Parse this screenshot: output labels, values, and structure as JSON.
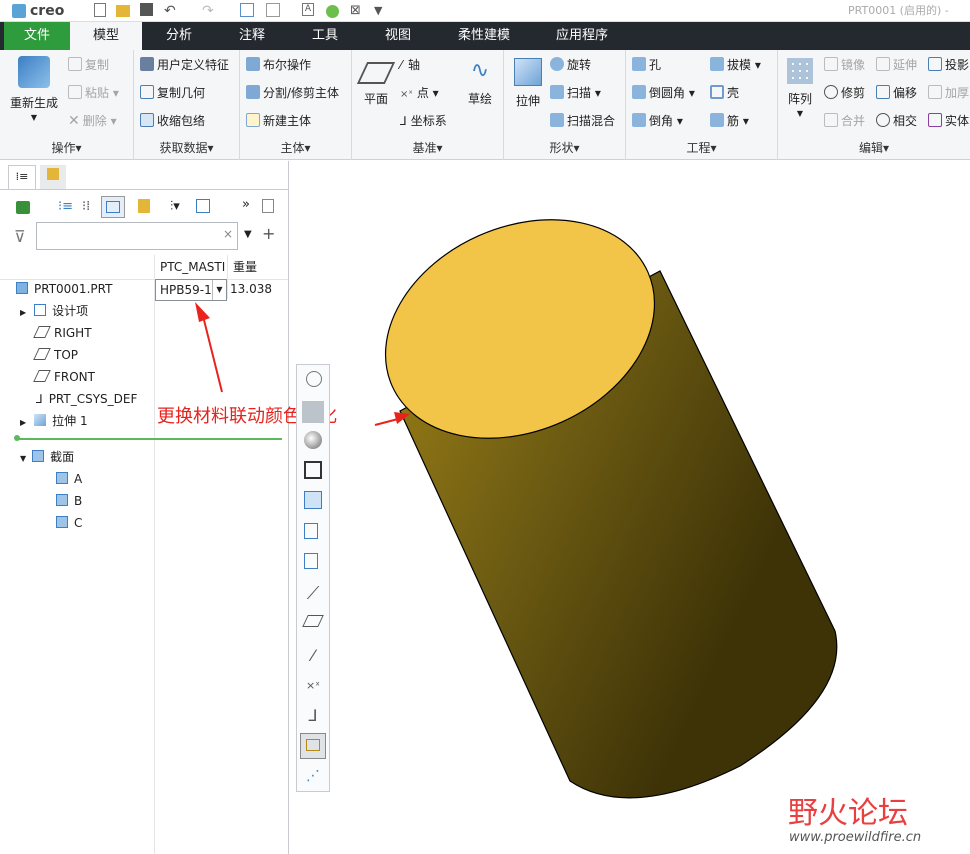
{
  "app": {
    "logo": "creo",
    "doc_title": "PRT0001 (启用的) -"
  },
  "menu": {
    "file": "文件",
    "tabs": [
      "模型",
      "分析",
      "注释",
      "工具",
      "视图",
      "柔性建模",
      "应用程序"
    ]
  },
  "ribbon": {
    "operations": {
      "label": "操作",
      "regen": "重新生成",
      "copy": "复制",
      "paste": "粘贴",
      "delete": "删除"
    },
    "getdata": {
      "label": "获取数据",
      "udf": "用户定义特征",
      "copygeom": "复制几何",
      "shrinkwrap": "收缩包络"
    },
    "body": {
      "label": "主体",
      "boolean": "布尔操作",
      "split": "分割/修剪主体",
      "newbody": "新建主体"
    },
    "datum": {
      "label": "基准",
      "plane": "平面",
      "axis": "轴",
      "point": "点",
      "csys": "坐标系",
      "sketch": "草绘"
    },
    "shapes": {
      "label": "形状",
      "extrude": "拉伸",
      "revolve": "旋转",
      "sweep": "扫描",
      "sweepblend": "扫描混合"
    },
    "engineering": {
      "label": "工程",
      "hole": "孔",
      "round": "倒圆角",
      "chamfer": "倒角",
      "draft": "拔模",
      "shell": "壳",
      "rib": "筋"
    },
    "editing": {
      "label": "编辑",
      "pattern": "阵列",
      "mirror": "镜像",
      "extend": "延伸",
      "project": "投影",
      "trim": "修剪",
      "offset": "偏移",
      "thicken": "加厚",
      "merge": "合并",
      "intersect": "相交",
      "solidify": "实体"
    }
  },
  "tree": {
    "col_param": "PTC_MASTI",
    "col_mass": "重量",
    "root": "PRT0001.PRT",
    "material": "HPB59-1",
    "mass": "13.038",
    "items": [
      "设计项",
      "RIGHT",
      "TOP",
      "FRONT",
      "PRT_CSYS_DEF",
      "拉伸 1"
    ],
    "sections_label": "截面",
    "sections": [
      "A",
      "B",
      "C"
    ]
  },
  "annotation": "更换材料联动颜色变化",
  "watermark": {
    "name": "野火论坛",
    "url": "www.proewildfire.cn"
  },
  "colors": {
    "accent": "#2e9c3c",
    "menubar": "#24292f",
    "cap": "#f2c447",
    "body": "#6b5a12"
  }
}
